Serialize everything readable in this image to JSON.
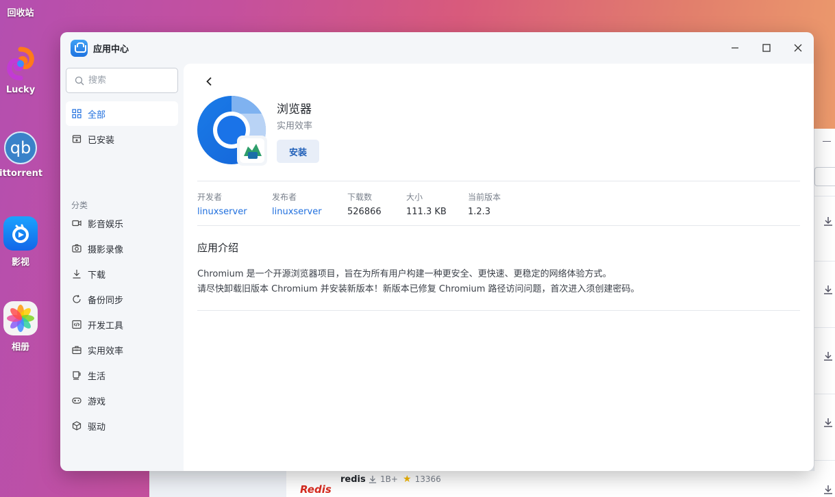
{
  "desktop": {
    "items": [
      {
        "label": "回收站"
      },
      {
        "label": "Lucky"
      },
      {
        "label": "qBittorrent"
      },
      {
        "label": "影视"
      },
      {
        "label": "相册"
      }
    ]
  },
  "window": {
    "title": "应用中心",
    "controls": {
      "minimize": "minimize",
      "maximize": "maximize",
      "close": "close"
    }
  },
  "sidebar": {
    "search_placeholder": "搜索",
    "top_items": [
      {
        "label": "全部",
        "icon": "grid-icon",
        "active": true
      },
      {
        "label": "已安装",
        "icon": "installed-box-icon",
        "active": false
      }
    ],
    "section_label": "分类",
    "categories": [
      {
        "label": "影音娱乐",
        "icon": "video-camera-icon"
      },
      {
        "label": "摄影录像",
        "icon": "camera-icon"
      },
      {
        "label": "下载",
        "icon": "download-icon"
      },
      {
        "label": "备份同步",
        "icon": "sync-icon"
      },
      {
        "label": "开发工具",
        "icon": "code-icon"
      },
      {
        "label": "实用效率",
        "icon": "toolbox-icon"
      },
      {
        "label": "生活",
        "icon": "cup-icon"
      },
      {
        "label": "游戏",
        "icon": "gamepad-icon"
      },
      {
        "label": "驱动",
        "icon": "cube-icon"
      }
    ]
  },
  "app": {
    "name": "浏览器",
    "category": "实用效率",
    "install_label": "安装",
    "meta": [
      {
        "label": "开发者",
        "value": "linuxserver",
        "link": true
      },
      {
        "label": "发布者",
        "value": "linuxserver",
        "link": true
      },
      {
        "label": "下载数",
        "value": "526866",
        "link": false
      },
      {
        "label": "大小",
        "value": "111.3 KB",
        "link": false
      },
      {
        "label": "当前版本",
        "value": "1.2.3",
        "link": false
      }
    ],
    "intro_title": "应用介绍",
    "intro_lines": [
      "Chromium 是一个开源浏览器项目，旨在为所有用户构建一种更安全、更快速、更稳定的网络体验方式。",
      "请尽快卸载旧版本 Chromium 并安装新版本！新版本已修复 Chromium 路径访问问题，首次进入须创建密码。"
    ]
  },
  "background_window": {
    "peek_app_name": "redis",
    "peek_downloads": "1B+",
    "peek_stars": "13366",
    "peek_logo_text": "Redis"
  },
  "colors": {
    "accent": "#1f6fde",
    "install_bg": "#e8eef8"
  }
}
